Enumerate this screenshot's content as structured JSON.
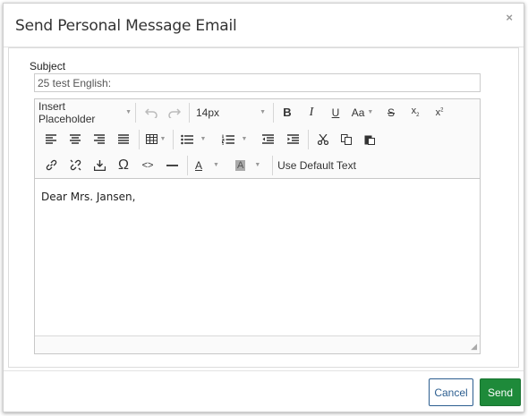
{
  "dialog": {
    "title": "Send Personal Message Email",
    "close_label": "×"
  },
  "subject": {
    "label": "Subject",
    "value": "25 test English:"
  },
  "toolbar": {
    "placeholder_label": "Insert Placeholder",
    "font_size": "14px",
    "case_label": "Aa",
    "default_text_label": "Use Default Text",
    "omega_label": "Ω",
    "code_label": "<>",
    "font_color_label": "A",
    "bg_color_label": "A"
  },
  "editor": {
    "content": "Dear Mrs. Jansen,"
  },
  "footer": {
    "cancel_label": "Cancel",
    "send_label": "Send"
  },
  "colors": {
    "send_button": "#1e8a3a",
    "cancel_border": "#2b5d8f"
  }
}
